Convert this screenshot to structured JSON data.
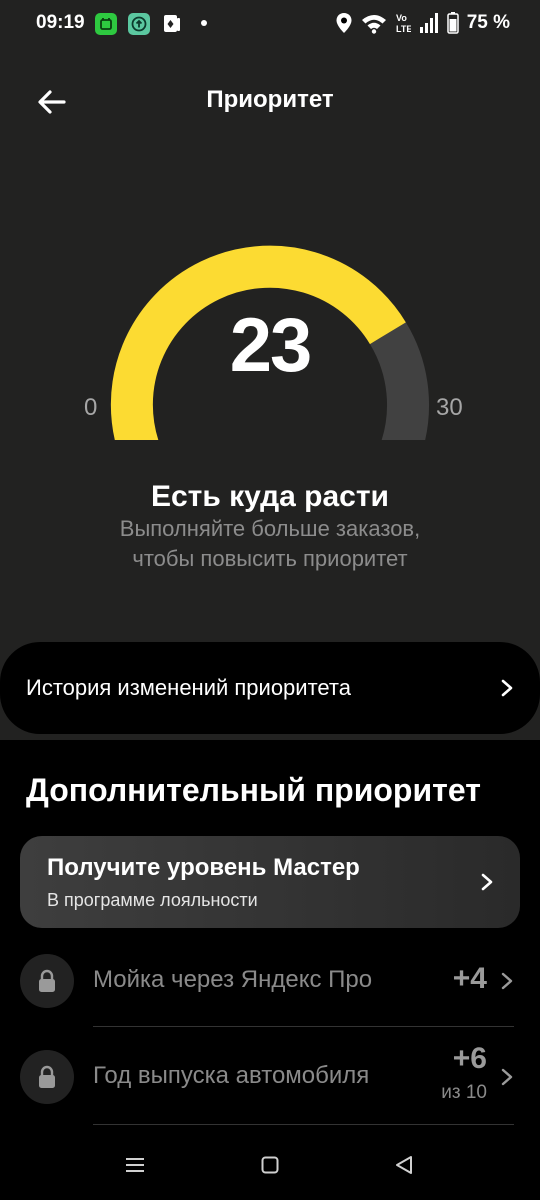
{
  "status_bar": {
    "time": "09:19",
    "battery": "75 %",
    "volte": "Vo LTE",
    "icons": [
      "notification-app-icon",
      "upload-app-icon",
      "cards-app-icon",
      "dot-icon",
      "location-icon",
      "wifi-icon",
      "volte-icon",
      "signal-icon",
      "battery-icon"
    ]
  },
  "header": {
    "title": "Приоритет",
    "back_icon": "arrow-left-icon"
  },
  "gauge": {
    "value": "23",
    "min": "0",
    "max": "30",
    "level": 23,
    "range": [
      0,
      30
    ],
    "fill_color": "#fcdb32",
    "track_color": "#414141"
  },
  "status": {
    "title": "Есть куда расти",
    "subtitle_line1": "Выполняйте больше заказов,",
    "subtitle_line2": "чтобы повысить приоритет"
  },
  "history": {
    "label": "История изменений приоритета"
  },
  "extra": {
    "title": "Дополнительный приоритет",
    "master": {
      "title": "Получите уровень Мастер",
      "subtitle": "В программе лояльности"
    },
    "items": [
      {
        "label": "Мойка через Яндекс Про",
        "value": "+4",
        "of": ""
      },
      {
        "label": "Год выпуска автомобиля",
        "value": "+6",
        "of": "из 10"
      }
    ]
  },
  "colors": {
    "accent": "#fcdb32",
    "background": "#222221",
    "sheet": "#000000"
  }
}
